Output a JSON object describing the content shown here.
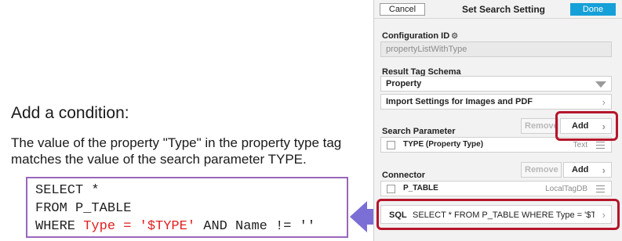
{
  "explanation": {
    "heading": "Add a condition:",
    "desc_line1": "The value of the property \"Type\" in the property type tag",
    "desc_line2": "matches the value of the search parameter TYPE.",
    "code": {
      "line1": "SELECT *",
      "line2": "FROM P_TABLE",
      "line3_pre": "WHERE ",
      "line3_red": "Type = '$TYPE'",
      "line3_post": " AND Name != ''"
    }
  },
  "dialog": {
    "cancel_label": "Cancel",
    "title": "Set Search Setting",
    "done_label": "Done",
    "config_label": "Configuration ID",
    "config_value": "propertyListWithType",
    "schema_label": "Result Tag Schema",
    "schema_value": "Property",
    "import_label": "Import Settings for Images and PDF",
    "search_param": {
      "section_label": "Search Parameter",
      "remove_label": "Remove",
      "add_label": "Add",
      "items": [
        {
          "name": "TYPE (Property Type)",
          "type": "Text"
        }
      ]
    },
    "connector": {
      "section_label": "Connector",
      "remove_label": "Remove",
      "add_label": "Add",
      "items": [
        {
          "name": "P_TABLE",
          "type": "LocalTagDB"
        }
      ]
    },
    "sql": {
      "label": "SQL",
      "query": "SELECT * FROM P_TABLE WHERE Type = '$TYP..."
    }
  },
  "colors": {
    "done_blue": "#16a0d8",
    "highlight_red": "#b5152b",
    "code_border": "#9966bb",
    "arrow": "#7b6fd6",
    "code_red": "#e02020"
  }
}
